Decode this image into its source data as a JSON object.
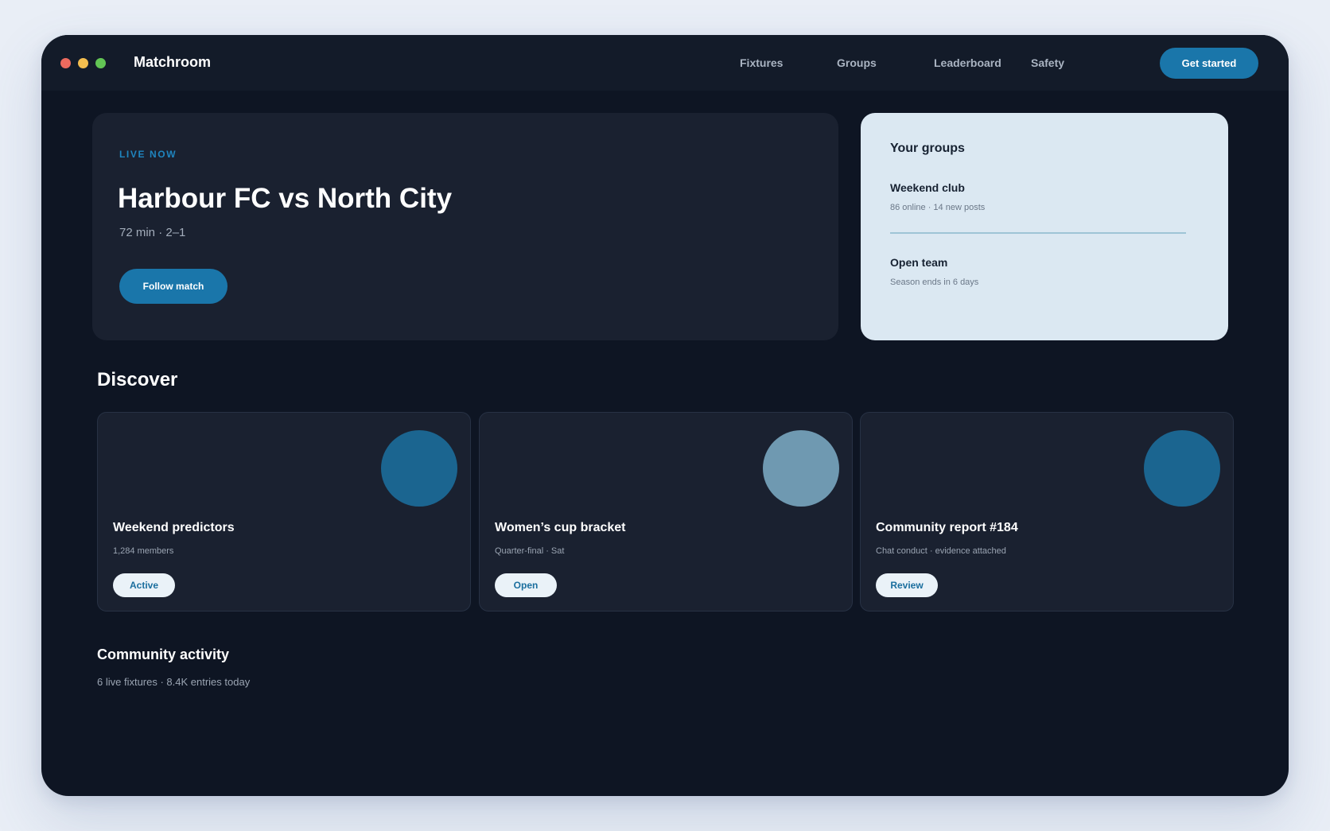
{
  "app": {
    "brand": "Matchroom",
    "window_controls": [
      "close",
      "minimize",
      "maximize"
    ]
  },
  "nav": {
    "items": [
      {
        "label": "Fixtures"
      },
      {
        "label": "Groups"
      },
      {
        "label": "Leaderboard"
      },
      {
        "label": "Safety"
      }
    ],
    "cta_label": "Get started"
  },
  "hero": {
    "eyebrow": "LIVE NOW",
    "title": "Harbour FC vs North City",
    "meta": "72 min · 2–1",
    "button_label": "Follow match"
  },
  "groups": {
    "title": "Your groups",
    "items": [
      {
        "name": "Weekend club",
        "meta": "86 online · 14 new posts"
      },
      {
        "name": "Open team",
        "meta": "Season ends in 6 days"
      }
    ]
  },
  "discover": {
    "title": "Discover",
    "cards": [
      {
        "title": "Weekend predictors",
        "meta": "1,284 members",
        "action": "Active",
        "circle_color": "#1b6590"
      },
      {
        "title": "Women’s cup bracket",
        "meta": "Quarter-final · Sat",
        "action": "Open",
        "circle_color": "#6f99b1"
      },
      {
        "title": "Community report #184",
        "meta": "Chat conduct · evidence attached",
        "action": "Review",
        "circle_color": "#1b6590"
      }
    ]
  },
  "activity": {
    "title": "Community activity",
    "meta": "6 live fixtures · 8.4K entries today"
  },
  "colors": {
    "background": "#e9eef6",
    "window": "#0e1523",
    "panel": "#1a2130",
    "accent": "#1a76aa",
    "groups_panel": "#dbe8f2"
  }
}
